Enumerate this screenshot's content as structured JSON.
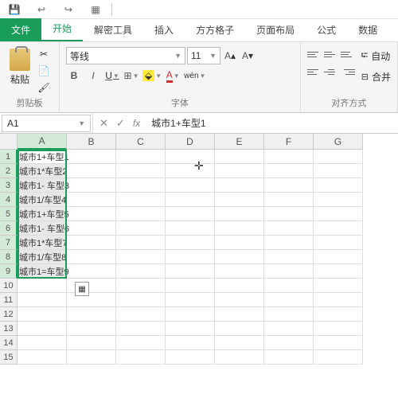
{
  "qat": {
    "save": "💾",
    "undo": "↩",
    "redo": "↪",
    "new": "▦"
  },
  "tabs": {
    "file": "文件",
    "home": "开始",
    "decrypt": "解密工具",
    "insert": "插入",
    "ffgz": "方方格子",
    "layout": "页面布局",
    "formula": "公式",
    "data": "数据"
  },
  "ribbon": {
    "clipboard": {
      "paste": "粘贴",
      "label": "剪贴板"
    },
    "font": {
      "name": "等线",
      "size": "11",
      "bold": "B",
      "italic": "I",
      "underline": "U",
      "wen": "wén",
      "label": "字体"
    },
    "align": {
      "wrap": "自动",
      "merge": "合并",
      "label": "对齐方式"
    }
  },
  "namebox": {
    "ref": "A1"
  },
  "formula": {
    "value": "城市1+车型1"
  },
  "columns": [
    "A",
    "B",
    "C",
    "D",
    "E",
    "F",
    "G"
  ],
  "rows": [
    1,
    2,
    3,
    4,
    5,
    6,
    7,
    8,
    9,
    10,
    11,
    12,
    13,
    14,
    15
  ],
  "cells": {
    "A1": "城市1+车型1",
    "A2": "城市1*车型2",
    "A3": "城市1- 车型3",
    "A4": "城市1/车型4",
    "A5": "城市1+车型5",
    "A6": "城市1- 车型6",
    "A7": "城市1*车型7",
    "A8": "城市1/车型8",
    "A9": "城市1=车型9"
  },
  "selection": {
    "startRow": 1,
    "endRow": 9,
    "col": "A"
  }
}
